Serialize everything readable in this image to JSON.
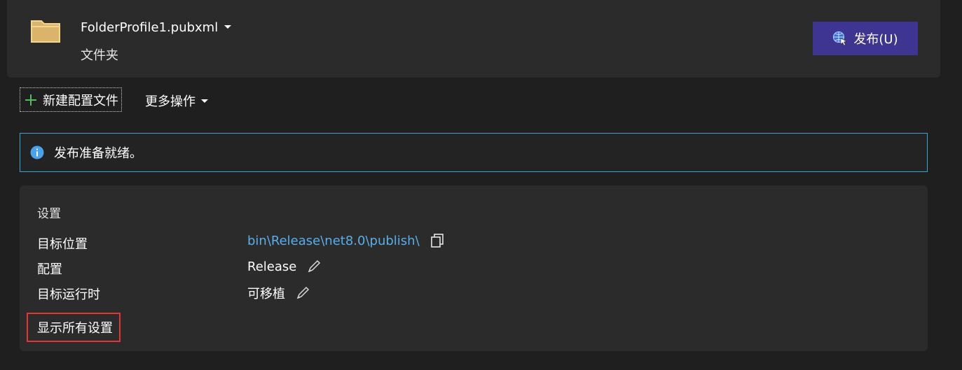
{
  "profile": {
    "name": "FolderProfile1.pubxml",
    "type": "文件夹",
    "publish_label": "发布(U)"
  },
  "toolbar": {
    "new_profile_label": "新建配置文件",
    "more_actions_label": "更多操作"
  },
  "info": {
    "message": "发布准备就绪。"
  },
  "settings": {
    "title": "设置",
    "rows": [
      {
        "label": "目标位置",
        "value": "bin\\Release\\net8.0\\publish\\",
        "icon": "copy-icon"
      },
      {
        "label": "配置",
        "value": "Release",
        "icon": "pencil-icon"
      },
      {
        "label": "目标运行时",
        "value": "可移植",
        "icon": "pencil-icon"
      }
    ],
    "show_all_label": "显示所有设置"
  },
  "colors": {
    "background": "#1f1f1f",
    "card": "#2b2b2b",
    "publish_button": "#3e3592",
    "link": "#5aaee8",
    "info_border": "#3ca3d6",
    "highlight_border": "#e03636"
  }
}
